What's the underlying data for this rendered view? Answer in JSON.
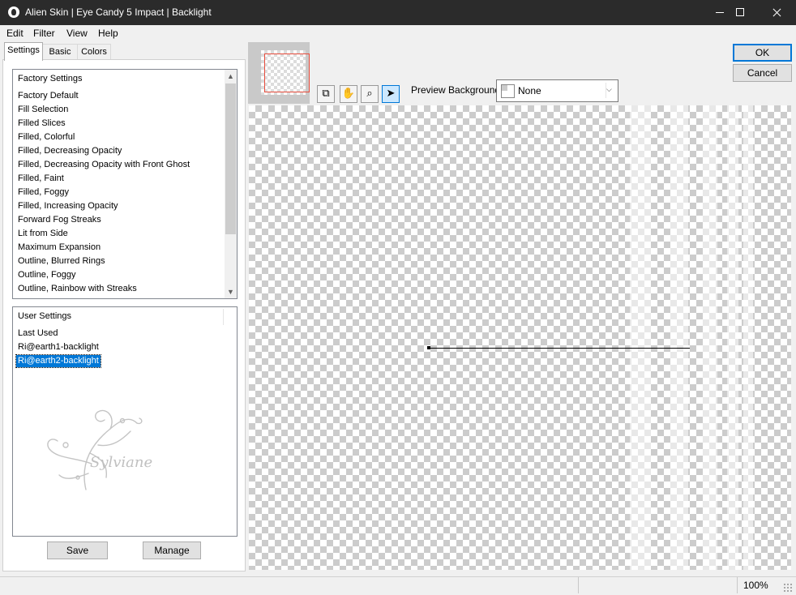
{
  "window": {
    "title": "Alien Skin | Eye Candy 5 Impact | Backlight"
  },
  "menu": [
    {
      "label": "Edit"
    },
    {
      "label": "Filter"
    },
    {
      "label": "View"
    },
    {
      "label": "Help"
    }
  ],
  "tabs": [
    {
      "label": "Settings",
      "active": true
    },
    {
      "label": "Basic"
    },
    {
      "label": "Colors"
    }
  ],
  "factory": {
    "header": "Factory Settings",
    "items": [
      "Factory Default",
      "Fill Selection",
      "Filled Slices",
      "Filled, Colorful",
      "Filled, Decreasing Opacity",
      "Filled, Decreasing Opacity with Front Ghost",
      "Filled, Faint",
      "Filled, Foggy",
      "Filled, Increasing Opacity",
      "Forward Fog Streaks",
      "Lit from Side",
      "Maximum Expansion",
      "Outline, Blurred Rings",
      "Outline, Foggy",
      "Outline, Rainbow with Streaks"
    ]
  },
  "user": {
    "header": "User Settings",
    "items": [
      "Last Used",
      "Ri@earth1-backlight",
      "Ri@earth2-backlight"
    ],
    "selected": "Ri@earth2-backlight",
    "watermark": "Sylviane"
  },
  "buttons": {
    "save": "Save",
    "manage": "Manage",
    "ok": "OK",
    "cancel": "Cancel"
  },
  "preview": {
    "background_label": "Preview Background:",
    "background_value": "None"
  },
  "tools": [
    "navigator-icon",
    "hand-icon",
    "zoom-icon",
    "pointer-icon"
  ],
  "status": {
    "zoom": "100%"
  },
  "colors": {
    "titlebar": "#2b2b2b",
    "selection": "#0078d7",
    "nav_rect": "#e74c3c"
  }
}
